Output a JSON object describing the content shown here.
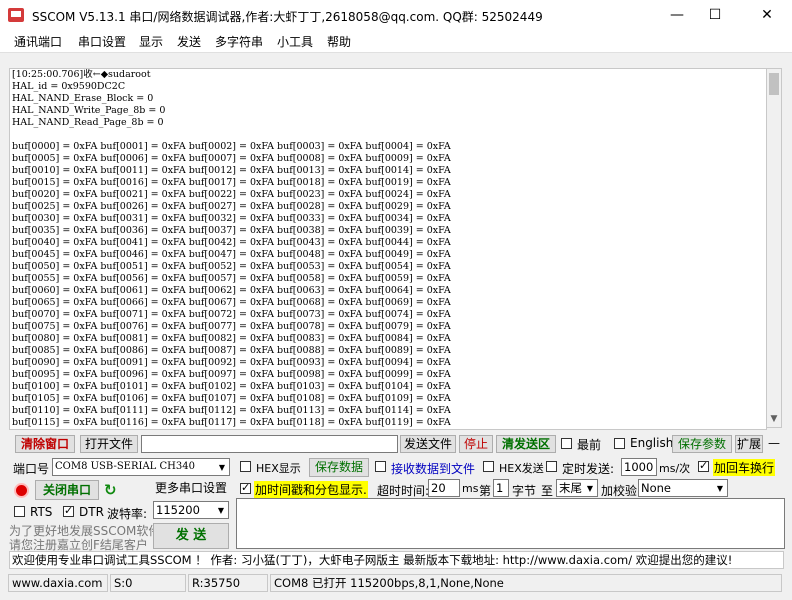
{
  "window": {
    "title": "SSCOM V5.13.1 串口/网络数据调试器,作者:大虾丁丁,2618058@qq.com. QQ群:  52502449",
    "minimize": "—",
    "maximize": "☐",
    "close": "✕"
  },
  "menu": [
    "通讯端口",
    "串口设置",
    "显示",
    "发送",
    "多字符串",
    "小工具",
    "帮助"
  ],
  "output": {
    "header": [
      "[10:25:00.706]收←◆sudaroot",
      "HAL_id = 0x9590DC2C",
      "HAL_NAND_Erase_Block = 0",
      "HAL_NAND_Write_Page_8b = 0",
      "HAL_NAND_Read_Page_8b = 0"
    ],
    "byte_value": "0xFA",
    "first_index": 0,
    "last_index": 119,
    "per_line": 5
  },
  "toolbar": {
    "clear_window": "清除窗口",
    "open_file": "打开文件",
    "file_path": "",
    "send_file": "发送文件",
    "stop": "停止",
    "clear_send_area": "清发送区",
    "last_label": "最前",
    "english_label": "English",
    "save_params": "保存参数",
    "expand": "扩展",
    "collapse": "—"
  },
  "port": {
    "label": "端口号",
    "value": "COM8 USB-SERIAL CH340",
    "hex_display": "HEX显示",
    "save_data": "保存数据",
    "receive_to_file": "接收数据到文件",
    "hex_send": "HEX发送",
    "timed_send": "定时发送:",
    "interval": "1000",
    "interval_unit": "ms/次",
    "append_crlf": "加回车换行"
  },
  "row3": {
    "close_port": "关闭串口",
    "more_settings": "更多串口设置",
    "timestamp": "加时间戳和分包显示.",
    "timeout_label": "超时时间:",
    "timeout": "20",
    "ms": "ms",
    "byte_no_label": "第",
    "byte_no": "1",
    "byte_label": "字节",
    "to_label": "至",
    "to_value": "末尾",
    "checksum_label": "加校验",
    "checksum": "None"
  },
  "row4": {
    "rts": "RTS",
    "dtr": "DTR",
    "baud_label": "波特率:",
    "baud": "115200",
    "promo_line1": "为了更好地发展SSCOM软件",
    "promo_line2": "请您注册嘉立创F结尾客户",
    "send": "发 送"
  },
  "checks": {
    "hex_display": false,
    "receive_to_file": false,
    "hex_send": false,
    "timed_send": false,
    "append_crlf": true,
    "timestamp": true,
    "rts": false,
    "dtr": true,
    "last": false,
    "english": false
  },
  "ticker": "欢迎使用专业串口调试工具SSCOM ！  作者: 习小猛(丁丁)，大虾电子网版主  最新版本下载地址: http://www.daxia.com/  欢迎提出您的建议! ",
  "status": {
    "site": "www.daxia.com",
    "sent": "S:0",
    "received": "R:35750",
    "port_status": "COM8 已打开  115200bps,8,1,None,None"
  }
}
